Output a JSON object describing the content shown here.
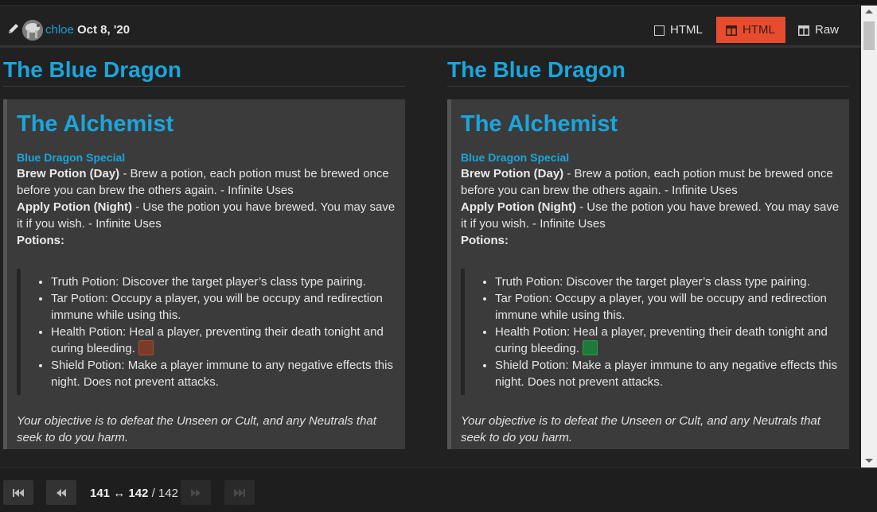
{
  "header": {
    "author": "chloe",
    "date": "Oct 8, '20",
    "view_buttons": [
      {
        "label": "HTML",
        "icon": "square-icon",
        "active": false
      },
      {
        "label": "HTML",
        "icon": "columns-icon",
        "active": true
      },
      {
        "label": "Raw",
        "icon": "columns-icon",
        "active": false
      }
    ]
  },
  "columns": [
    {
      "page_title": "The Blue Dragon",
      "card_title": "The Alchemist",
      "special": "Blue Dragon Special",
      "ability1_name": "Brew Potion (Day)",
      "ability1_text": " - Brew a potion, each potion must be brewed once before you can brew the others again. - Infinite Uses",
      "ability2_name": "Apply Potion (Night)",
      "ability2_text": " - Use the potion you have brewed. You may save it if you wish. - Infinite Uses",
      "potions_label": "Potions:",
      "potions": [
        "Truth Potion: Discover the target player’s class type pairing.",
        "Tar Potion: Occupy a player, you will be occupy and redirection immune while using this.",
        "Health Potion: Heal a player, preventing their death tonight and curing bleeding.",
        "Shield Potion: Make a player immune to any negative effects this night. Does not prevent attacks."
      ],
      "objective": "Your objective is to defeat the Unseen or Cult, and any Neutrals that seek to do you harm."
    },
    {
      "page_title": "The Blue Dragon",
      "card_title": "The Alchemist",
      "special": "Blue Dragon Special",
      "ability1_name": "Brew Potion (Day)",
      "ability1_text": " - Brew a potion, each potion must be brewed once before you can brew the others again. - Infinite Uses",
      "ability2_name": "Apply Potion (Night)",
      "ability2_text": " - Use the potion you have brewed. You may save it if you wish. - Infinite Uses",
      "potions_label": "Potions:",
      "potions": [
        "Truth Potion: Discover the target player’s class type pairing.",
        "Tar Potion: Occupy a player, you will be occupy and redirection immune while using this.",
        "Health Potion: Heal a player, preventing their death tonight and curing bleeding.",
        "Shield Potion: Make a player immune to any negative effects this night. Does not prevent attacks."
      ],
      "objective": "Your objective is to defeat the Unseen or Cult, and any Neutrals that seek to do you harm."
    }
  ],
  "footer": {
    "from": "141",
    "arrow": "↔",
    "to": "142",
    "separator": "/",
    "total": "142"
  },
  "colors": {
    "accent": "#1ba5dc",
    "active_button": "#e74c2f",
    "background": "#212121",
    "card": "#3b3b3b"
  }
}
